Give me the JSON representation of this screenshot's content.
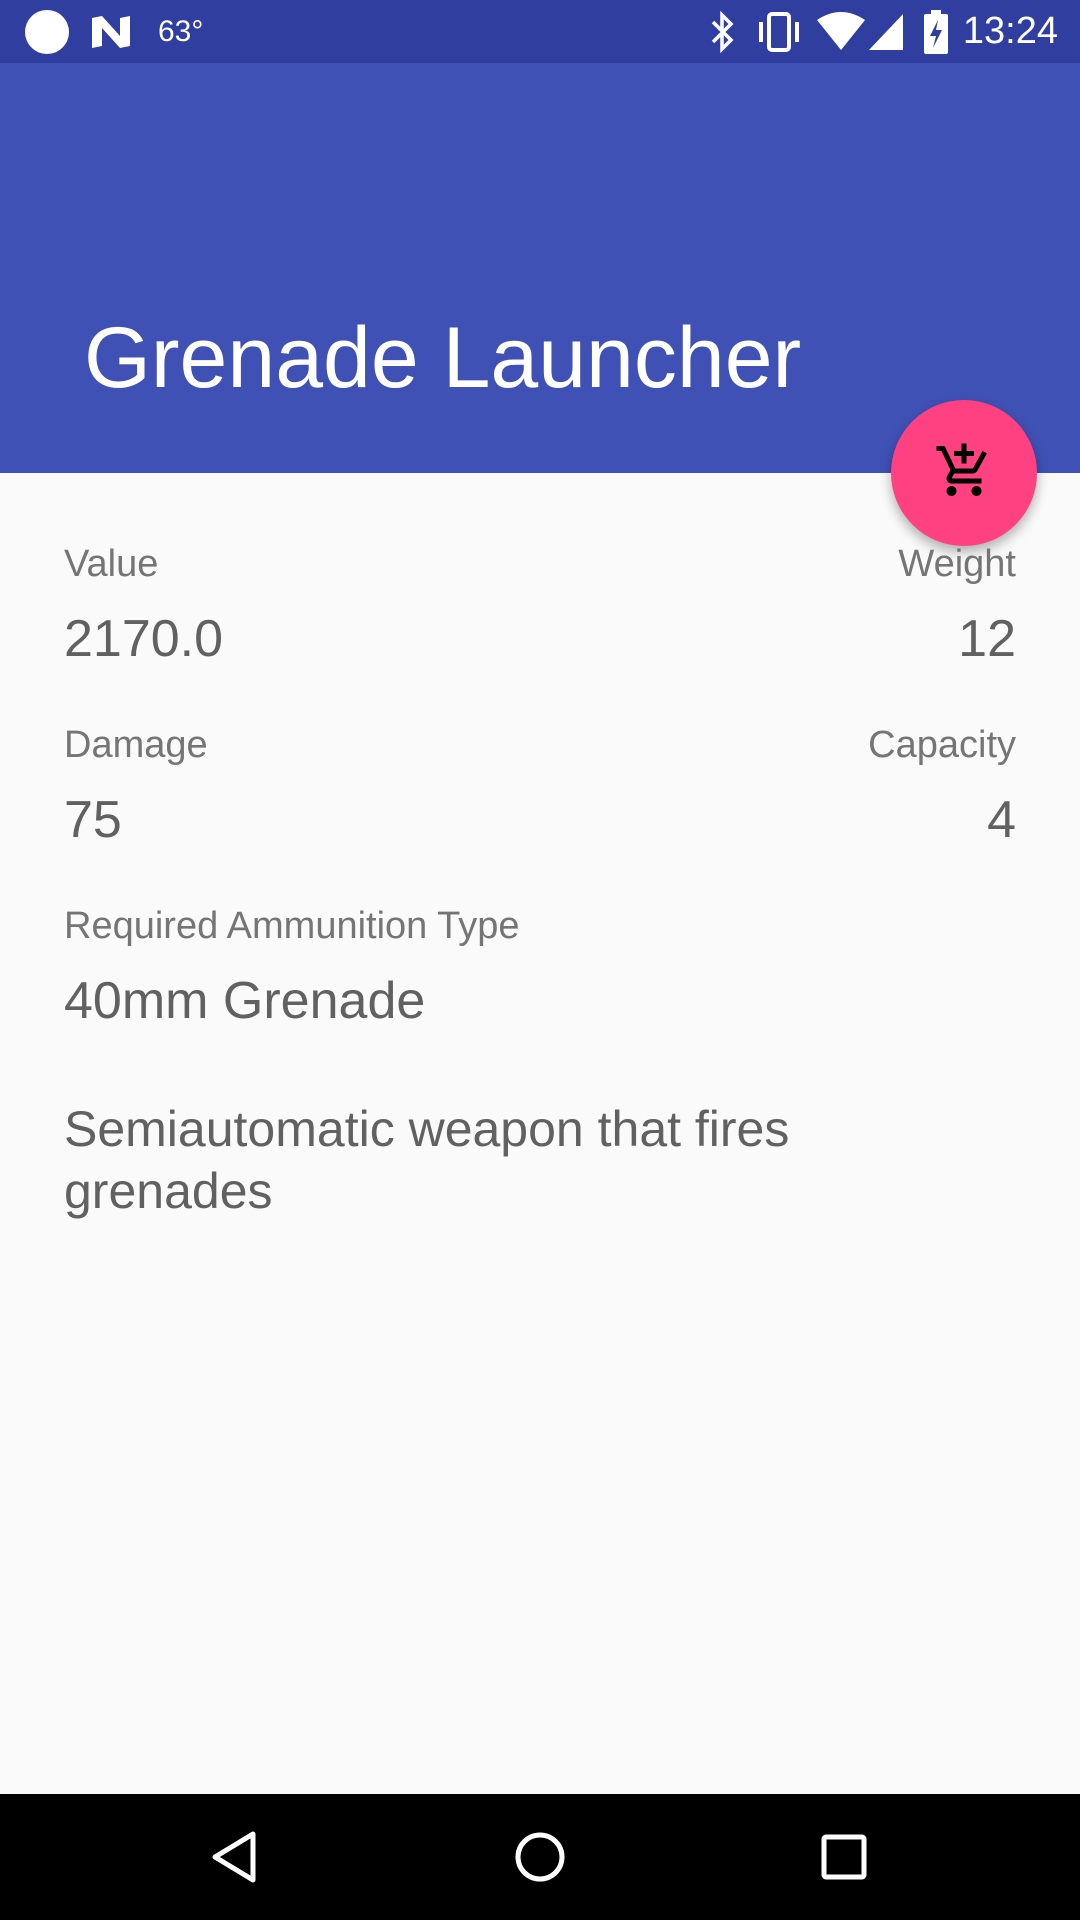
{
  "status_bar": {
    "temperature": "63°",
    "time": "13:24",
    "icons": [
      "circle-notification-icon",
      "n-notification-icon",
      "bluetooth-icon",
      "vibrate-icon",
      "wifi-icon",
      "cellular-signal-icon",
      "battery-charging-icon"
    ]
  },
  "app_bar": {
    "title": "Grenade Launcher",
    "color": "#3f51b5"
  },
  "fab": {
    "icon": "add-shopping-cart-icon",
    "color": "#ff4081"
  },
  "stats": {
    "value_label": "Value",
    "value": "2170.0",
    "weight_label": "Weight",
    "weight": "12",
    "damage_label": "Damage",
    "damage": "75",
    "capacity_label": "Capacity",
    "capacity": "4",
    "ammo_label": "Required Ammunition Type",
    "ammo": "40mm Grenade"
  },
  "description": "Semiautomatic weapon that fires grenades",
  "nav_bar": {
    "icons": [
      "back-icon",
      "home-icon",
      "recents-icon"
    ]
  }
}
